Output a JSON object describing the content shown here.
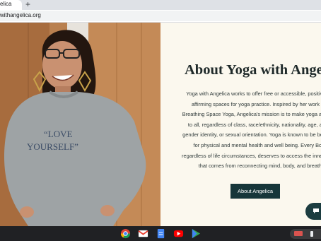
{
  "browser": {
    "tab_title": "elica",
    "new_tab_icon": "+",
    "url": "withangelica.org"
  },
  "page": {
    "photo_icon": "person-photo",
    "photo_sweater_text": [
      "“LOVE",
      "YOURSELF”"
    ],
    "about_title": "About Yoga with Angelica",
    "about_paragraph": "Yoga with Angelica works to offer free or accessible, positive and affirming spaces for yoga practice. Inspired by her work with Breathing Space Yoga, Angelica's mission is to make yoga available to all, regardless of class, race/ethnicity, nationality, age, ability, gender identity, or sexual orientation. Yoga is known to be beneficial for physical and mental health and well being. Every Body, regardless of life circumstances, deserves to access the inner peace that comes from reconnecting mind, body, and breath.",
    "about_button": "About Angelica",
    "chat_icon": "chat-bubble-icon",
    "colors": {
      "background": "#fbf8ee",
      "button": "#16363a",
      "title": "#1f2a2a"
    }
  },
  "shelf": {
    "apps": [
      "chrome-icon",
      "gmail-icon",
      "docs-icon",
      "youtube-icon",
      "play-store-icon"
    ],
    "status": [
      "screen-icon",
      "phone-icon"
    ]
  }
}
